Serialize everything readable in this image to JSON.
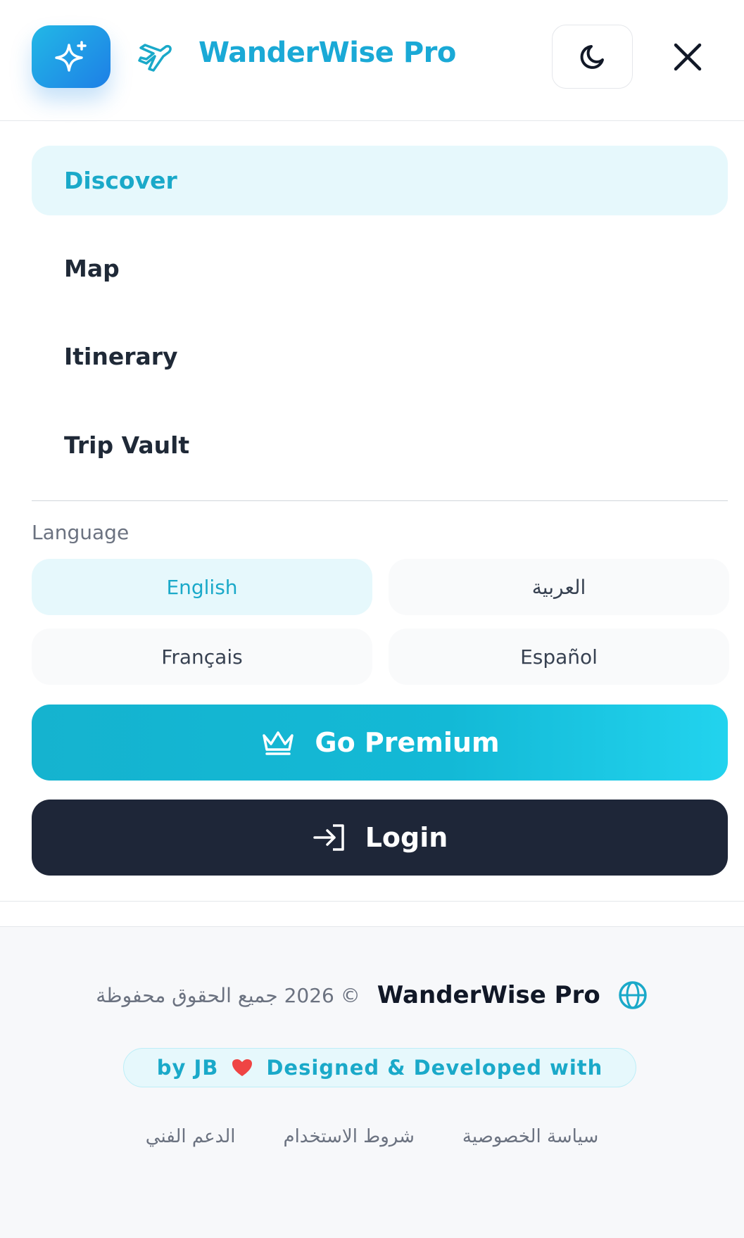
{
  "header": {
    "brand": "WanderWise Pro",
    "logo_icon": "sparkles-icon",
    "plane_icon": "plane-icon",
    "theme_icon": "moon-icon",
    "close_icon": "close-icon"
  },
  "nav": {
    "items": [
      {
        "label": "Discover",
        "active": true
      },
      {
        "label": "Map",
        "active": false
      },
      {
        "label": "Itinerary",
        "active": false
      },
      {
        "label": "Trip Vault",
        "active": false
      }
    ]
  },
  "language": {
    "label": "Language",
    "options": [
      {
        "label": "English",
        "active": true
      },
      {
        "label": "العربية",
        "active": false
      },
      {
        "label": "Français",
        "active": false
      },
      {
        "label": "Español",
        "active": false
      }
    ]
  },
  "actions": {
    "premium_label": "Go Premium",
    "premium_icon": "crown-icon",
    "login_label": "Login",
    "login_icon": "login-icon"
  },
  "footer": {
    "copyright": "© 2026 جميع الحقوق محفوظة",
    "brand": "WanderWise Pro",
    "globe_icon": "globe-icon",
    "credit_left": "by JB",
    "credit_right": "Designed & Developed with",
    "heart_icon": "heart-icon",
    "links": [
      "سياسة الخصوصية",
      "شروط الاستخدام",
      "الدعم الفني"
    ]
  },
  "colors": {
    "accent": "#1aa9c9",
    "dark": "#1e2638",
    "active_bg": "#e6f8fc"
  }
}
